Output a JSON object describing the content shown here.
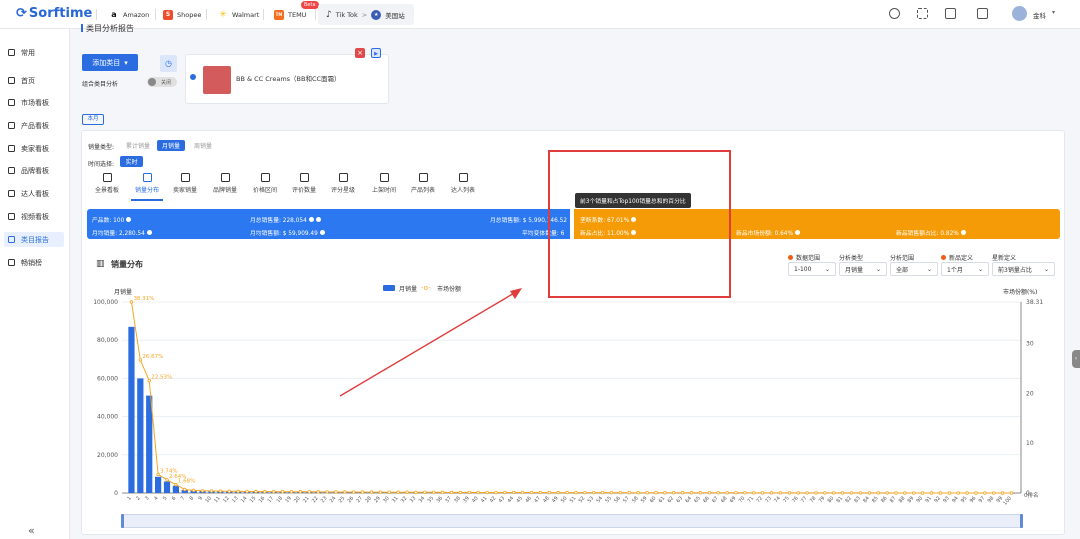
{
  "app": {
    "logo": "Sorftime"
  },
  "tabs": [
    {
      "label": "Amazon",
      "icon": "amazon-icon"
    },
    {
      "label": "Shopee",
      "icon": "shopee-icon"
    },
    {
      "label": "Walmart",
      "icon": "walmart-icon"
    },
    {
      "label": "TEMU",
      "icon": "temu-icon",
      "badge": "Beta"
    },
    {
      "label": "Tik Tok",
      "icon": "tiktok-icon"
    }
  ],
  "breadcrumb": {
    "sep": ">",
    "site": "美国站"
  },
  "user": {
    "name": "金科"
  },
  "sidebar": {
    "items": [
      {
        "label": "常用",
        "icon": "shield-icon"
      },
      {
        "label": "首页",
        "icon": "home-icon"
      },
      {
        "label": "市场看板",
        "icon": "market-icon"
      },
      {
        "label": "产品看板",
        "icon": "product-icon"
      },
      {
        "label": "卖家看板",
        "icon": "seller-icon"
      },
      {
        "label": "品牌看板",
        "icon": "brand-icon"
      },
      {
        "label": "达人看板",
        "icon": "influencer-icon"
      },
      {
        "label": "视频看板",
        "icon": "video-icon"
      },
      {
        "label": "类目报告",
        "icon": "report-icon",
        "active": true
      },
      {
        "label": "畅销榜",
        "icon": "bestseller-icon"
      }
    ],
    "collapse": "«"
  },
  "page": {
    "title": "类目分析报告",
    "add_category": "添加类目",
    "combine_label": "组合类目分析",
    "toggle_off": "关闭",
    "category_name": "BB & CC Creams（BB和CC面霜）",
    "month_tag": "本月",
    "sales_type_label": "销量类型:",
    "sales_types": [
      "累计销量",
      "月销量",
      "周销量"
    ],
    "time_label": "时间选择:",
    "time_value": "实时"
  },
  "nav_tabs": [
    {
      "label": "全景看板"
    },
    {
      "label": "销量分布",
      "active": true
    },
    {
      "label": "卖家销量"
    },
    {
      "label": "品牌销量"
    },
    {
      "label": "价格区间"
    },
    {
      "label": "评价数量"
    },
    {
      "label": "评分星级"
    },
    {
      "label": "上架时间"
    },
    {
      "label": "产品列表"
    },
    {
      "label": "达人列表"
    }
  ],
  "stats_blue": {
    "products": "产品数: 100",
    "monthly_total": "月总销售量: 228,054",
    "monthly_amount": "月总销售额: $ 5,990,146.52",
    "avg_monthly": "月均销量: 2,280.54",
    "avg_amount": "月均销售额: $ 59,909.49",
    "avg_store": "平均变体数量: 6"
  },
  "stats_orange": {
    "concentration": "垄断系数: 67.01%",
    "new_ratio": "新品占比: 11.00%",
    "new_market_share": "新品市场份额: 0.64%",
    "new_sales_share": "新品销售额占比: 0.82%"
  },
  "tooltip": "前3个销量和占Top100销量总和的百分比",
  "chart_section": {
    "title": "销量分布",
    "filters": [
      {
        "label": "数据范围",
        "value": "1-100",
        "dot": true
      },
      {
        "label": "分析类型",
        "value": "月销量"
      },
      {
        "label": "分析范围",
        "value": "全部"
      },
      {
        "label": "新品定义",
        "value": "1个月",
        "dot": true
      },
      {
        "label": "星新定义",
        "value": "前3销量占比"
      }
    ]
  },
  "chart_data": {
    "type": "bar",
    "legend": [
      "月销量",
      "市场份额"
    ],
    "ylabel_left": "月销量",
    "ylabel_right": "市场份额(%)",
    "y_left_ticks": [
      "0",
      "20,000",
      "40,000",
      "60,000",
      "80,000",
      "100,000"
    ],
    "y_left_lim": [
      0,
      100000
    ],
    "y_right_ticks": [
      "0",
      "10",
      "20",
      "30",
      "38.31"
    ],
    "y_right_lim": [
      0,
      38.31
    ],
    "x_suffix": "0排名",
    "categories": [
      "1",
      "2",
      "3",
      "4",
      "5",
      "6",
      "7",
      "8",
      "9",
      "10",
      "11",
      "12",
      "13",
      "14",
      "15",
      "16",
      "17",
      "18",
      "19",
      "20",
      "21",
      "22",
      "23",
      "24",
      "25",
      "26",
      "27",
      "28",
      "29",
      "30",
      "31",
      "32",
      "33",
      "34",
      "35",
      "36",
      "37",
      "38",
      "39",
      "40",
      "41",
      "42",
      "43",
      "44",
      "45",
      "46",
      "47",
      "48",
      "49",
      "50",
      "51",
      "52",
      "53",
      "54",
      "55",
      "56",
      "57",
      "58",
      "59",
      "60",
      "61",
      "62",
      "63",
      "64",
      "65",
      "66",
      "67",
      "68",
      "69",
      "70",
      "71",
      "72",
      "73",
      "74",
      "75",
      "76",
      "77",
      "78",
      "79",
      "80",
      "81",
      "82",
      "83",
      "84",
      "85",
      "86",
      "87",
      "88",
      "89",
      "90",
      "91",
      "92",
      "93",
      "94",
      "95",
      "96",
      "97",
      "98",
      "99",
      "100"
    ],
    "series": [
      {
        "name": "月销量",
        "values": [
          87000,
          60000,
          51000,
          8500,
          6000,
          3800,
          1600,
          1200,
          1000,
          900,
          850,
          800,
          750,
          700,
          680,
          650,
          620,
          600,
          580,
          560,
          540,
          520,
          500,
          480,
          460,
          440,
          420,
          400,
          380,
          360,
          350,
          340,
          330,
          320,
          310,
          300,
          290,
          280,
          270,
          260,
          250,
          240,
          230,
          220,
          210,
          200,
          195,
          190,
          185,
          180,
          175,
          170,
          165,
          160,
          155,
          150,
          145,
          140,
          135,
          130,
          125,
          120,
          115,
          110,
          105,
          100,
          95,
          90,
          85,
          80,
          75,
          70,
          65,
          60,
          58,
          56,
          54,
          52,
          50,
          48,
          46,
          44,
          42,
          40,
          38,
          36,
          34,
          32,
          30,
          28,
          26,
          24,
          22,
          20,
          18,
          16,
          14,
          12,
          10,
          8
        ]
      },
      {
        "name": "市场份额",
        "labels": [
          "38.31%",
          "26.67%",
          "22.53%",
          "3.74%",
          "2.64%",
          "1.68%"
        ],
        "values": [
          38.31,
          26.67,
          22.53,
          3.74,
          2.64,
          1.68,
          0.7,
          0.53,
          0.44,
          0.39,
          0.37,
          0.35,
          0.33,
          0.31,
          0.3,
          0.28,
          0.27,
          0.26,
          0.25,
          0.25,
          0.24,
          0.23,
          0.22,
          0.21,
          0.2,
          0.19,
          0.18,
          0.18,
          0.17,
          0.16,
          0.15,
          0.15,
          0.14,
          0.14,
          0.14,
          0.13,
          0.13,
          0.12,
          0.12,
          0.11,
          0.11,
          0.11,
          0.1,
          0.1,
          0.09,
          0.09,
          0.09,
          0.08,
          0.08,
          0.08,
          0.08,
          0.07,
          0.07,
          0.07,
          0.07,
          0.07,
          0.06,
          0.06,
          0.06,
          0.06,
          0.05,
          0.05,
          0.05,
          0.05,
          0.05,
          0.04,
          0.04,
          0.04,
          0.04,
          0.04,
          0.03,
          0.03,
          0.03,
          0.03,
          0.03,
          0.02,
          0.02,
          0.02,
          0.02,
          0.02,
          0.02,
          0.02,
          0.02,
          0.02,
          0.02,
          0.02,
          0.01,
          0.01,
          0.01,
          0.01,
          0.01,
          0.01,
          0.01,
          0.01,
          0.01,
          0.01,
          0.01,
          0.01,
          0.0,
          0.0
        ]
      }
    ],
    "colors": {
      "bar": "#2b6de0",
      "line": "#f5a623"
    }
  },
  "colors": {
    "accent": "#2b6de0",
    "orange": "#f59b07",
    "red": "#e03c3c"
  }
}
